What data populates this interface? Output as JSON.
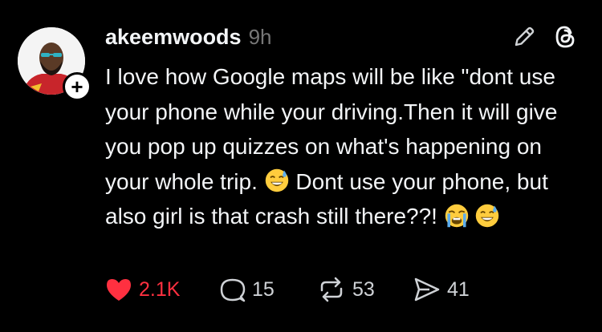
{
  "post": {
    "username": "akeemwoods",
    "time": "9h",
    "text_before_emoji": "I love how Google maps will be like \"dont use your phone while your driving.Then it will give you pop up quizzes on what's happening on your whole trip. ",
    "text_middle": " Dont use your phone, but also girl is that crash still there??! ",
    "emojis": [
      "sweat-smile-emoji",
      "loudly-crying-emoji",
      "sweat-smile-emoji"
    ]
  },
  "actions": {
    "likes": "2.1K",
    "comments": "15",
    "reposts": "53",
    "shares": "41"
  },
  "colors": {
    "like": "#ff3040",
    "background": "#000000",
    "text": "#f3f5f7",
    "muted": "#777777"
  },
  "icons": [
    "edit-pencil-icon",
    "threads-logo-icon",
    "heart-icon",
    "comment-icon",
    "repost-icon",
    "share-icon",
    "plus-icon"
  ]
}
